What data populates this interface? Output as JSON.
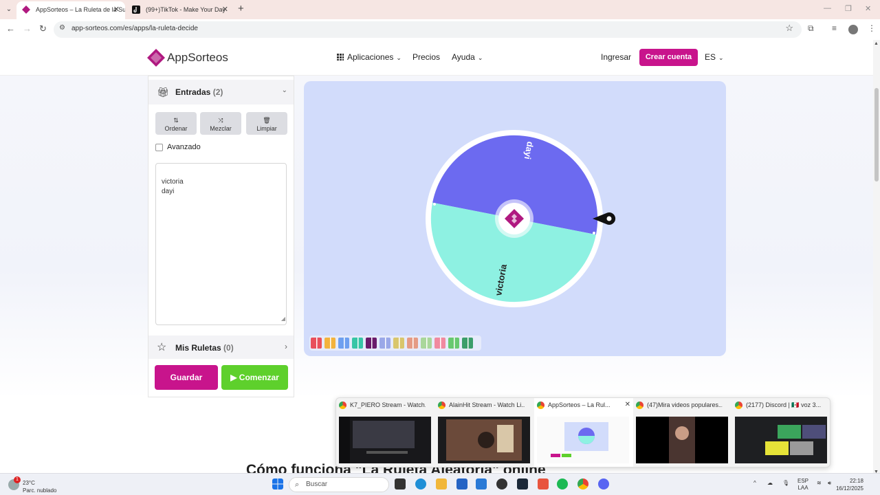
{
  "browser": {
    "tabs": [
      {
        "title": "AppSorteos – La Ruleta de la Suerte",
        "active": true
      },
      {
        "title": "(99+)TikTok - Make Your Day",
        "active": false
      }
    ],
    "url": "app-sorteos.com/es/apps/la-ruleta-decide"
  },
  "header": {
    "brand": "AppSorteos",
    "nav": {
      "aplicaciones": "Aplicaciones",
      "precios": "Precios",
      "ayuda": "Ayuda"
    },
    "login": "Ingresar",
    "signup": "Crear cuenta",
    "lang": "ES"
  },
  "panel": {
    "entries_title": "Entradas",
    "entries_count": "(2)",
    "tools": {
      "sort": "Ordenar",
      "shuffle": "Mezclar",
      "clear": "Limpiar"
    },
    "advanced_label": "Avanzado",
    "entries": [
      "victoria",
      "dayi"
    ],
    "my_wheels_title": "Mis Ruletas",
    "my_wheels_count": "(0)",
    "save": "Guardar",
    "start": "Comenzar"
  },
  "wheel": {
    "segments": [
      {
        "label": "dayi",
        "color": "#6c6af0"
      },
      {
        "label": "victoria",
        "color": "#8ef1e2"
      }
    ],
    "theme_swatches": [
      "#e94f5b",
      "#f3b33d",
      "#6ea0f0",
      "#37c5a6",
      "#6a1b6b",
      "#9aa8e8",
      "#d9c66c",
      "#e59b85",
      "#a9d79b",
      "#f08aa0",
      "#68c96f",
      "#3b9e6a"
    ]
  },
  "page": {
    "howto_heading": "Cómo funciona \"La Ruleta Aleatoria\" online"
  },
  "preview": {
    "windows": [
      {
        "title": "K7_PIERO Stream - Watch..."
      },
      {
        "title": "AlainHit Stream - Watch Li..."
      },
      {
        "title": "AppSorteos – La Rul..."
      },
      {
        "title": "(47)Mira videos populares..."
      },
      {
        "title": "(2177) Discord | 🇲🇽 voz 3..."
      }
    ]
  },
  "taskbar": {
    "temp": "23°C",
    "weather": "Parc. nublado",
    "search_placeholder": "Buscar",
    "lang_top": "ESP",
    "lang_bottom": "LAA",
    "time": "22:18",
    "date": "16/12/2025",
    "notif_count": "1"
  }
}
